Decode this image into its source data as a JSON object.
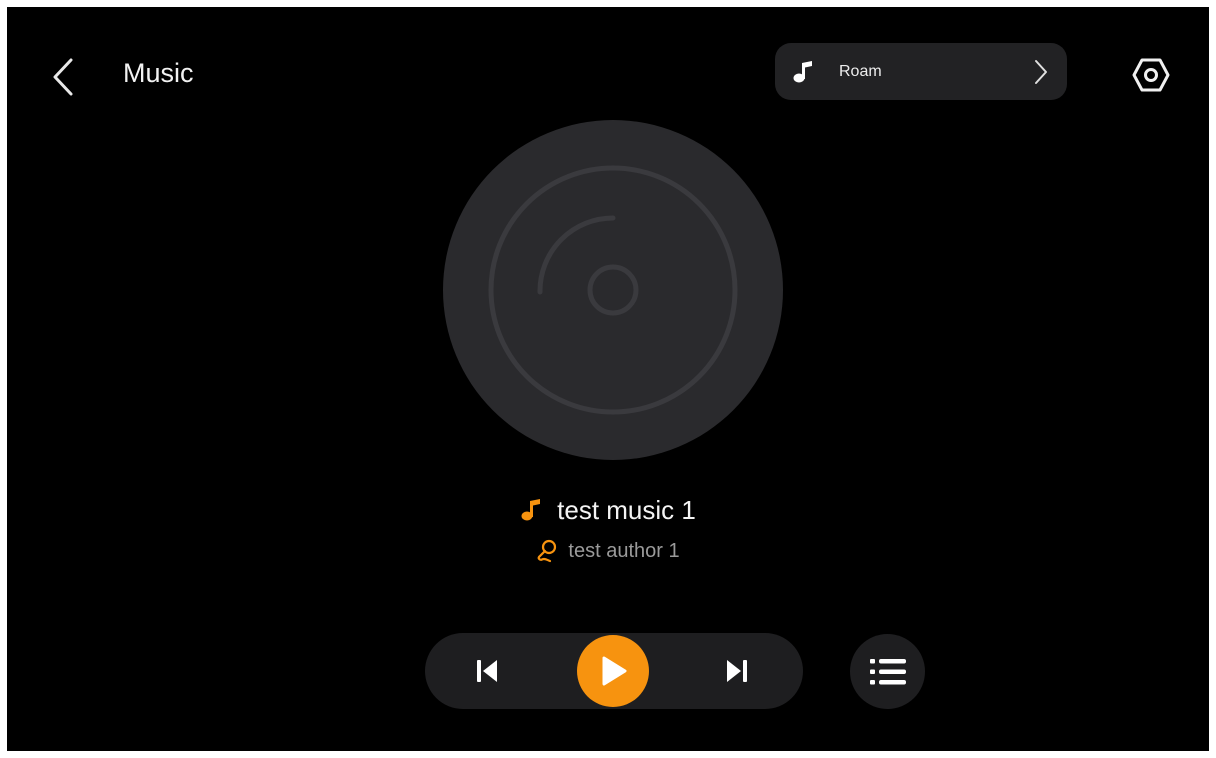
{
  "header": {
    "title": "Music",
    "back_icon": "chevron-left-icon",
    "settings_icon": "hexagon-settings-icon"
  },
  "play_mode": {
    "label": "Roam",
    "icon": "music-note-icon",
    "chevron_icon": "chevron-right-icon"
  },
  "track": {
    "title": "test music 1",
    "author": "test author 1",
    "title_icon": "music-note-icon",
    "author_icon": "microphone-icon"
  },
  "controls": {
    "prev_icon": "skip-previous-icon",
    "play_icon": "play-icon",
    "next_icon": "skip-next-icon",
    "playlist_icon": "playlist-icon"
  },
  "colors": {
    "accent": "#f7930f",
    "background": "#000000",
    "surface": "#1e1e20",
    "disc": "#2a2a2d",
    "text_primary": "#f4f4f4",
    "text_secondary": "#9a9a9a"
  }
}
